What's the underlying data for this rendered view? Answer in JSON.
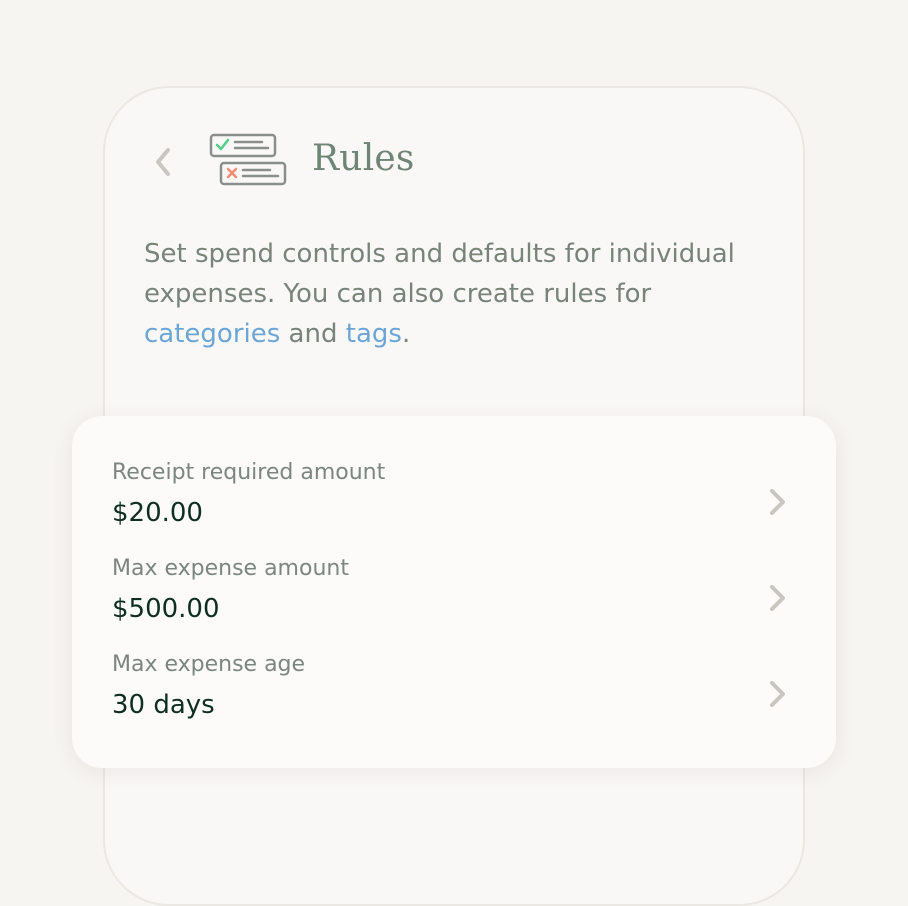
{
  "header": {
    "title": "Rules",
    "back_icon": "chevron-left-icon",
    "feature_icon": "rules-checklist-icon"
  },
  "description": {
    "text_before": "Set spend controls and defaults for individual expenses. You can also create rules for ",
    "link1": "categories",
    "text_middle": " and ",
    "link2": "tags",
    "text_after": "."
  },
  "rules": [
    {
      "label": "Receipt required amount",
      "value": "$20.00"
    },
    {
      "label": "Max expense amount",
      "value": "$500.00"
    },
    {
      "label": "Max expense age",
      "value": "30 days"
    }
  ],
  "colors": {
    "background": "#f7f5f1",
    "title": "#6f8576",
    "link": "#6ba6d7",
    "value_text": "#0f2e22",
    "check": "#4fcf87",
    "cross": "#f08b73"
  }
}
